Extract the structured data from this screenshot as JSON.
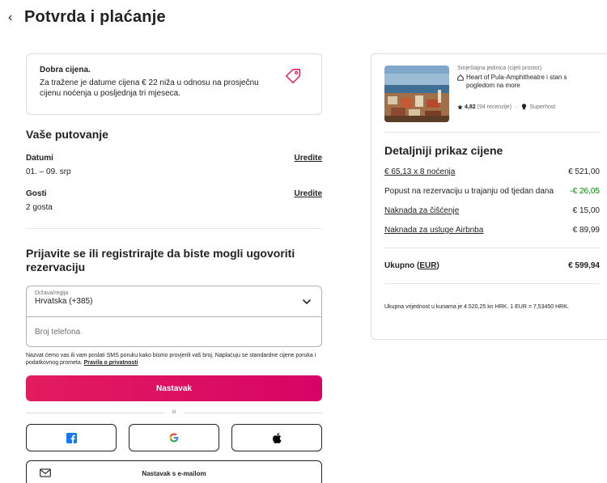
{
  "page": {
    "title": "Potvrda i plaćanje",
    "back_glyph": "‹"
  },
  "notice": {
    "title": "Dobra cijena.",
    "text": "Za tražene je datume cijena € 22 niža u odnosu na prosječnu cijenu noćenja u posljednja tri mjeseca.",
    "icon": "price-tag-icon",
    "icon_color": "#e31c5f"
  },
  "trip": {
    "title": "Vaše putovanje",
    "dates_label": "Datumi",
    "dates_value": "01. – 09. srp",
    "guests_label": "Gosti",
    "guests_value": "2 gosta",
    "edit_label": "Uredite"
  },
  "login": {
    "title": "Prijavite se ili registrirajte da biste mogli ugovoriti rezervaciju",
    "country_label": "Država/regija",
    "country_value": "Hrvatska (+385)",
    "phone_placeholder": "Broj telefona",
    "sms_note": "Nazvat ćemo vas ili vam poslati SMS poruku kako bismo provjerili vaš broj. Naplaćuju se standardne cijene poruka i podatkovnog prometa.",
    "privacy_link": "Pravila o privatnosti",
    "continue_label": "Nastavak",
    "or_text": "ili",
    "email_label": "Nastavak s e-mailom"
  },
  "social": [
    {
      "name": "facebook",
      "icon": "facebook-icon",
      "color": "#1877f2"
    },
    {
      "name": "google",
      "icon": "google-icon",
      "color": "#4285f4"
    },
    {
      "name": "apple",
      "icon": "apple-icon",
      "color": "#000000"
    }
  ],
  "listing": {
    "type": "Smještajna jedinica (cijeli prostor)",
    "name": "Heart of Pula-Amphitheatre i stan s pogledom na more",
    "rating": "4,82",
    "reviews": "(94 recenzije)",
    "superhost": "Superhost"
  },
  "price": {
    "title": "Detaljniji prikaz cijene",
    "rows": [
      {
        "label": "€ 65,13 x 8 noćenja",
        "value": "€ 521,00",
        "link": true,
        "discount": false
      },
      {
        "label": "Popust na rezervaciju u trajanju od tjedan dana",
        "value": "-€ 26,05",
        "link": false,
        "discount": true
      },
      {
        "label": "Naknada za čišćenje",
        "value": "€ 15,00",
        "link": true,
        "discount": false
      },
      {
        "label": "Naknada za usluge Airbnba",
        "value": "€ 89,99",
        "link": true,
        "discount": false
      }
    ],
    "total_label": "Ukupno (",
    "total_currency": "EUR",
    "total_label_end": ")",
    "total_value": "€ 599,94",
    "hrk_note": "Ukupna vrijednost u kunama je 4.520,25 kn HRK. 1 EUR = 7,53450 HRK."
  },
  "colors": {
    "brand": "#e31c5f",
    "discount": "#008a05",
    "text": "#222222",
    "muted": "#717171",
    "border": "#dddddd"
  }
}
